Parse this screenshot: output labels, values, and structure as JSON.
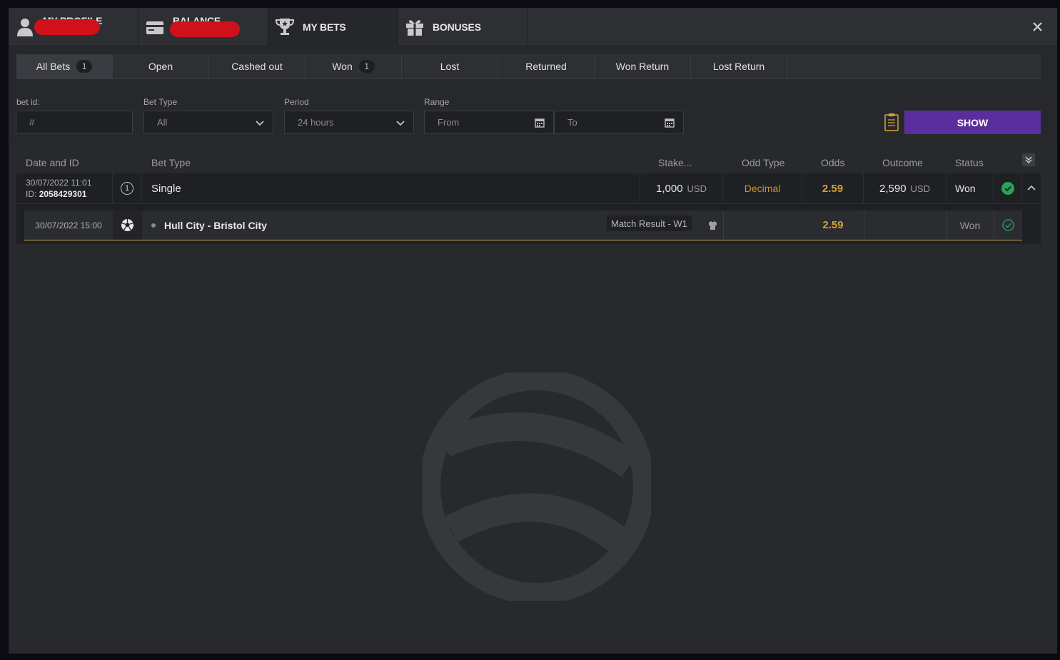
{
  "topnav": {
    "tabs": [
      {
        "label": "MY PROFILE",
        "icon": "user-icon",
        "redacted": true
      },
      {
        "label": "BALANCE",
        "icon": "wallet-icon",
        "redacted": true
      },
      {
        "label": "MY BETS",
        "icon": "trophy-icon",
        "active": true
      },
      {
        "label": "BONUSES",
        "icon": "gift-icon"
      }
    ],
    "close_icon": "close-icon"
  },
  "filter_tabs": [
    {
      "label": "All Bets",
      "count": "1",
      "active": true
    },
    {
      "label": "Open"
    },
    {
      "label": "Cashed out"
    },
    {
      "label": "Won",
      "count": "1"
    },
    {
      "label": "Lost"
    },
    {
      "label": "Returned"
    },
    {
      "label": "Won Return"
    },
    {
      "label": "Lost Return"
    }
  ],
  "filters": {
    "bet_id_label": "bet id:",
    "bet_id_placeholder": "#",
    "bet_type_label": "Bet Type",
    "bet_type_value": "All",
    "period_label": "Period",
    "period_value": "24 hours",
    "range_label": "Range",
    "range_from": "From",
    "range_to": "To",
    "show_label": "SHOW"
  },
  "table": {
    "headers": {
      "date_id": "Date and ID",
      "bet_type": "Bet Type",
      "stake": "Stake...",
      "odd_type": "Odd Type",
      "odds": "Odds",
      "outcome": "Outcome",
      "status": "Status"
    },
    "bet": {
      "datetime": "30/07/2022 11:01",
      "id_prefix": "ID:",
      "id": "2058429301",
      "type_number": "1",
      "type": "Single",
      "stake": "1,000",
      "stake_currency": "USD",
      "odd_type": "Decimal",
      "odds": "2.59",
      "outcome": "2,590",
      "outcome_currency": "USD",
      "status": "Won"
    },
    "event": {
      "datetime": "30/07/2022 15:00",
      "sport_icon": "soccer-ball-icon",
      "name": "Hull City - Bristol City",
      "market": "Match Result - W1",
      "odds": "2.59",
      "status": "Won"
    }
  },
  "colors": {
    "accent": "#5b2d9e",
    "gold": "#d4a037",
    "won": "#27a35a",
    "background": "#27282c"
  }
}
